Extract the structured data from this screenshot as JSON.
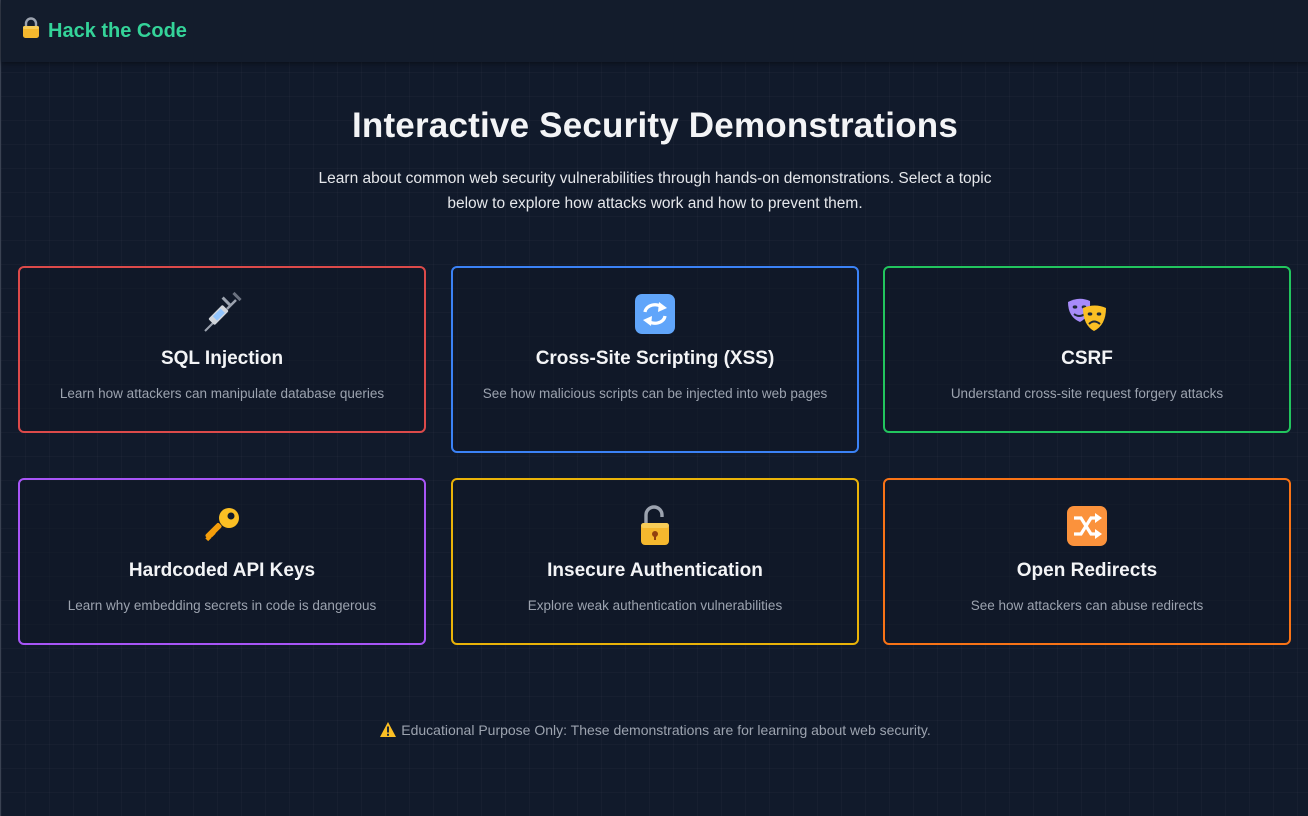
{
  "navbar": {
    "brand": "Hack the Code",
    "brand_icon": "lock-icon"
  },
  "hero": {
    "title": "Interactive Security Demonstrations",
    "description": "Learn about common web security vulnerabilities through hands-on demonstrations. Select a topic below to explore how attacks work and how to prevent them."
  },
  "cards": [
    {
      "title": "SQL Injection",
      "description": "Learn how attackers can manipulate database queries",
      "icon": "syringe-icon",
      "border_color": "#dc4a4a"
    },
    {
      "title": "Cross-Site Scripting (XSS)",
      "description": "See how malicious scripts can be injected into web pages",
      "icon": "arrows-cycle-icon",
      "border_color": "#3b82f6"
    },
    {
      "title": "CSRF",
      "description": "Understand cross-site request forgery attacks",
      "icon": "theater-masks-icon",
      "border_color": "#22c55e"
    },
    {
      "title": "Hardcoded API Keys",
      "description": "Learn why embedding secrets in code is dangerous",
      "icon": "key-icon",
      "border_color": "#a855f7"
    },
    {
      "title": "Insecure Authentication",
      "description": "Explore weak authentication vulnerabilities",
      "icon": "unlocked-padlock-icon",
      "border_color": "#eab308"
    },
    {
      "title": "Open Redirects",
      "description": "See how attackers can abuse redirects",
      "icon": "shuffle-icon",
      "border_color": "#f97316"
    }
  ],
  "footer": {
    "note": "Educational Purpose Only: These demonstrations are for learning about web security.",
    "icon": "warning-icon"
  },
  "colors": {
    "brand_accent": "#34d399",
    "background": "#111a2b"
  }
}
